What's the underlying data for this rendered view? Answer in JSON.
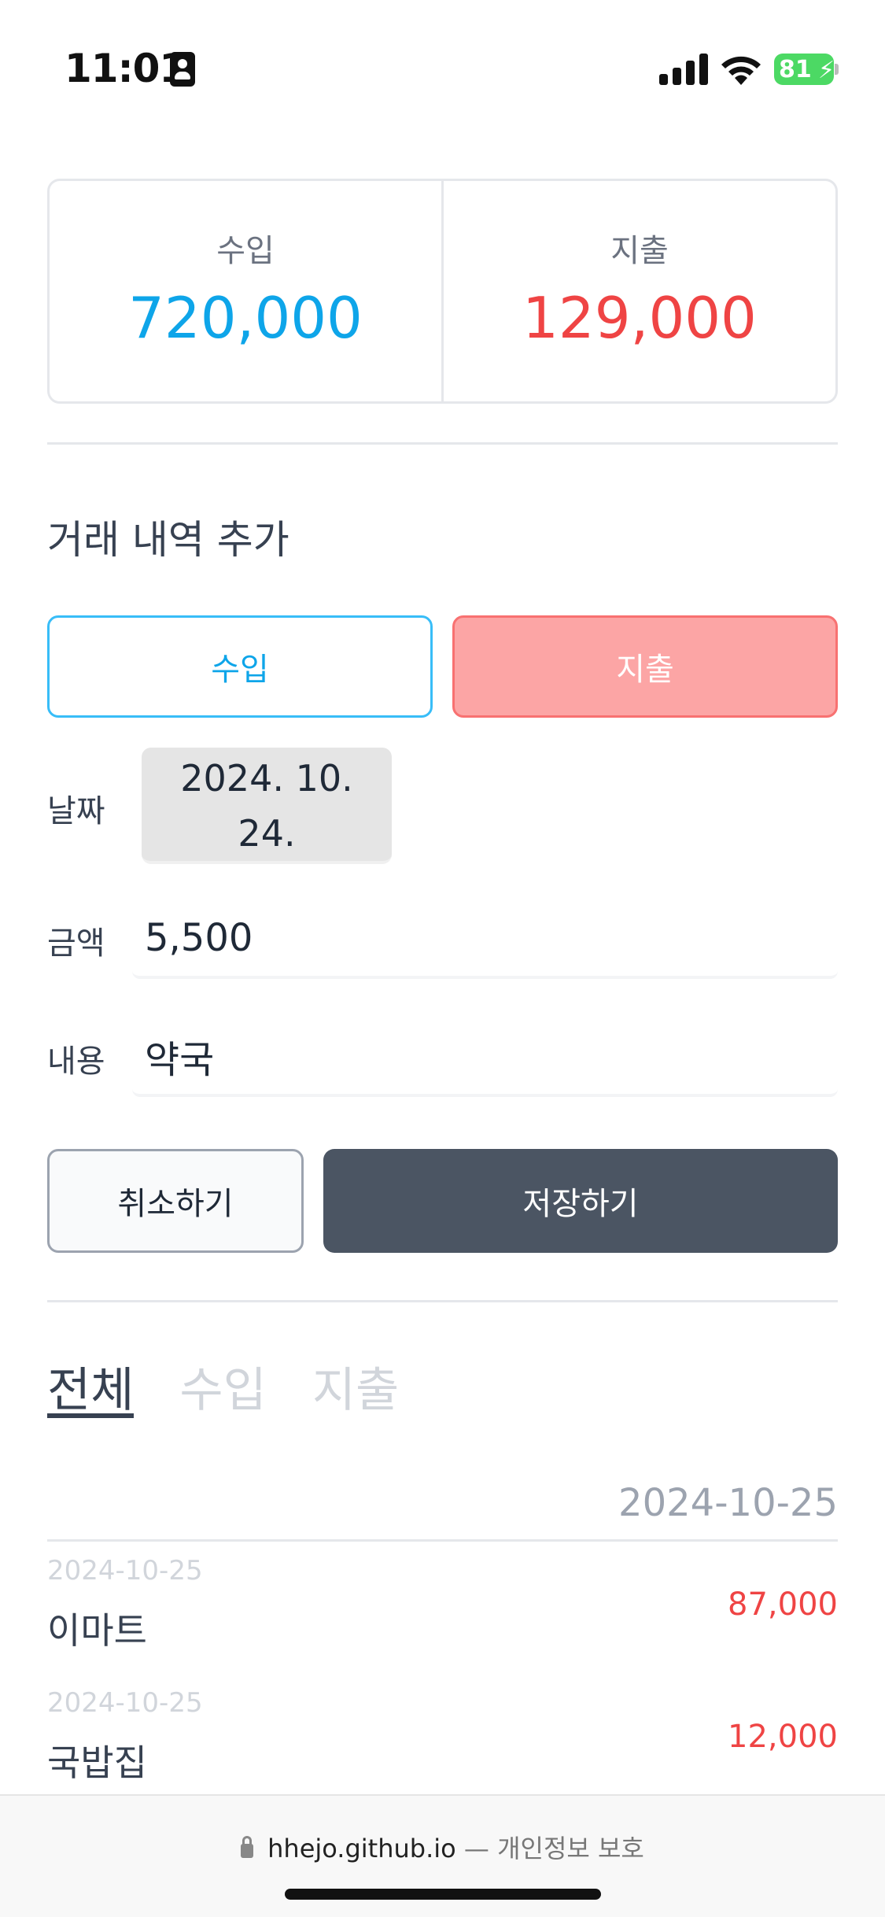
{
  "status_bar": {
    "time": "11:01",
    "battery": "81"
  },
  "summary": {
    "income_label": "수입",
    "income_value": "720,000",
    "expense_label": "지출",
    "expense_value": "129,000"
  },
  "form": {
    "title": "거래 내역 추가",
    "type_income": "수입",
    "type_expense": "지출",
    "selected_type": "지출",
    "date_label": "날짜",
    "date_line1": "2024. 10.",
    "date_line2": "24.",
    "amount_label": "금액",
    "amount_value": "5,500",
    "memo_label": "내용",
    "memo_value": "약국",
    "cancel_label": "취소하기",
    "save_label": "저장하기"
  },
  "tabs": [
    {
      "label": "전체",
      "active": true
    },
    {
      "label": "수입",
      "active": false
    },
    {
      "label": "지출",
      "active": false
    }
  ],
  "list": {
    "group_date": "2024-10-25",
    "items": [
      {
        "date": "2024-10-25",
        "name": "이마트",
        "amount": "87,000"
      },
      {
        "date": "2024-10-25",
        "name": "국밥집",
        "amount": "12,000"
      }
    ]
  },
  "browser": {
    "domain": "hhejo.github.io",
    "privacy": "— 개인정보 보호"
  },
  "colors": {
    "income": "#0ea5e9",
    "expense": "#ef4444",
    "save_button": "#4b5563"
  }
}
